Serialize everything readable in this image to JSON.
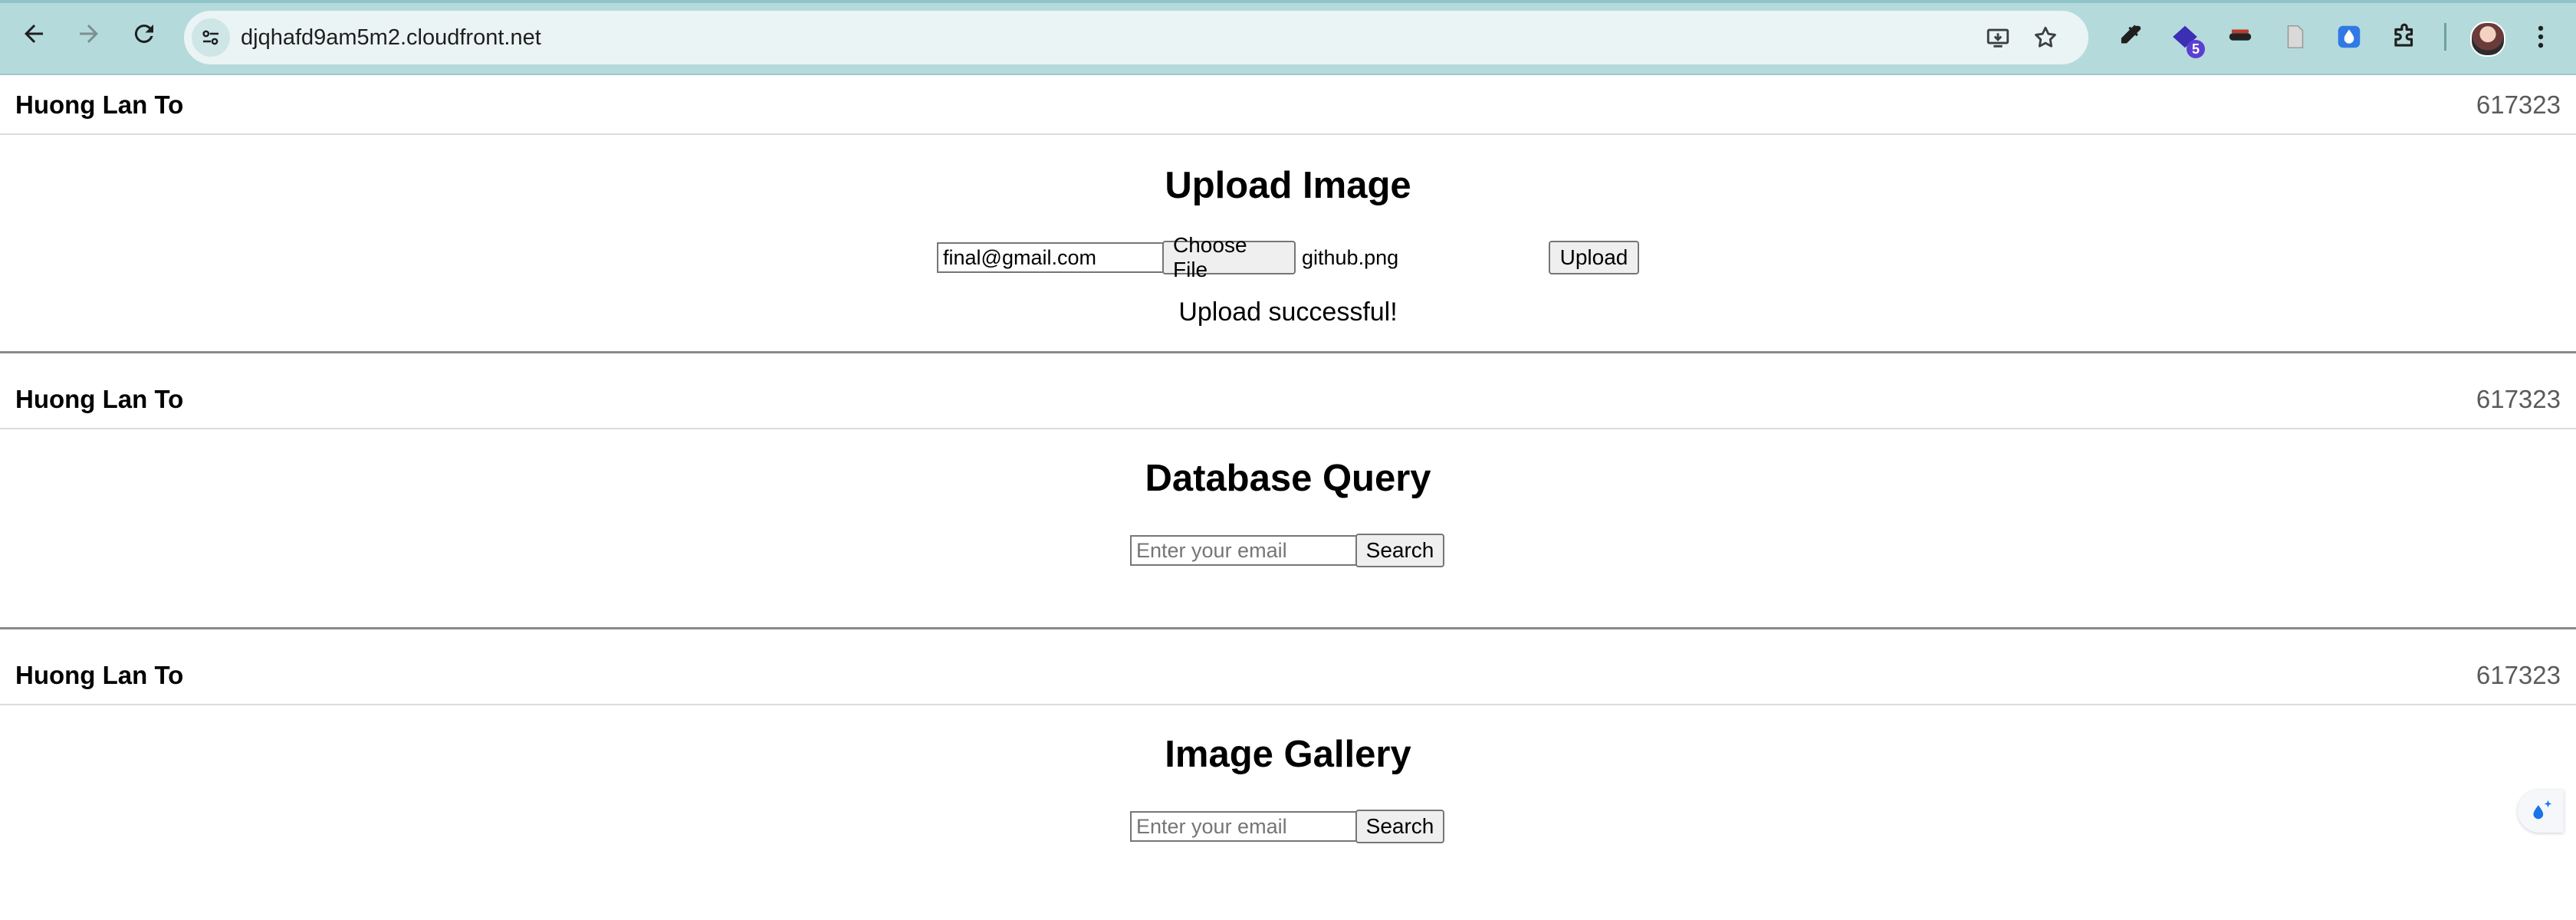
{
  "browser": {
    "url": "djqhafd9am5m2.cloudfront.net",
    "extension_badge": "5",
    "icons": {
      "back": "back-arrow-icon",
      "forward": "forward-arrow-icon",
      "reload": "reload-icon",
      "site_info": "tune-icon",
      "install": "install-app-icon",
      "bookmark": "star-icon",
      "eyedropper": "eyedropper-icon",
      "extension_badge_ext": "cap-extension-icon",
      "mask": "mask-extension-icon",
      "doc": "document-extension-icon",
      "drop": "drop-extension-icon",
      "puzzle": "extensions-puzzle-icon",
      "menu": "kebab-menu-icon"
    }
  },
  "sections": {
    "upload": {
      "header_name": "Huong Lan To",
      "header_id": "617323",
      "title": "Upload Image",
      "email_value": "final@gmail.com",
      "choose_file_label": "Choose File",
      "file_name": "github.png",
      "upload_label": "Upload",
      "status": "Upload successful!"
    },
    "query": {
      "header_name": "Huong Lan To",
      "header_id": "617323",
      "title": "Database Query",
      "email_placeholder": "Enter your email",
      "search_label": "Search"
    },
    "gallery": {
      "header_name": "Huong Lan To",
      "header_id": "617323",
      "title": "Image Gallery",
      "email_placeholder": "Enter your email",
      "search_label": "Search"
    }
  },
  "colors": {
    "chrome_bg": "#b5dadc",
    "omnibox_bg": "#eaf4f4",
    "badge": "#5b3fd1",
    "separator": "#8a8a8a"
  }
}
